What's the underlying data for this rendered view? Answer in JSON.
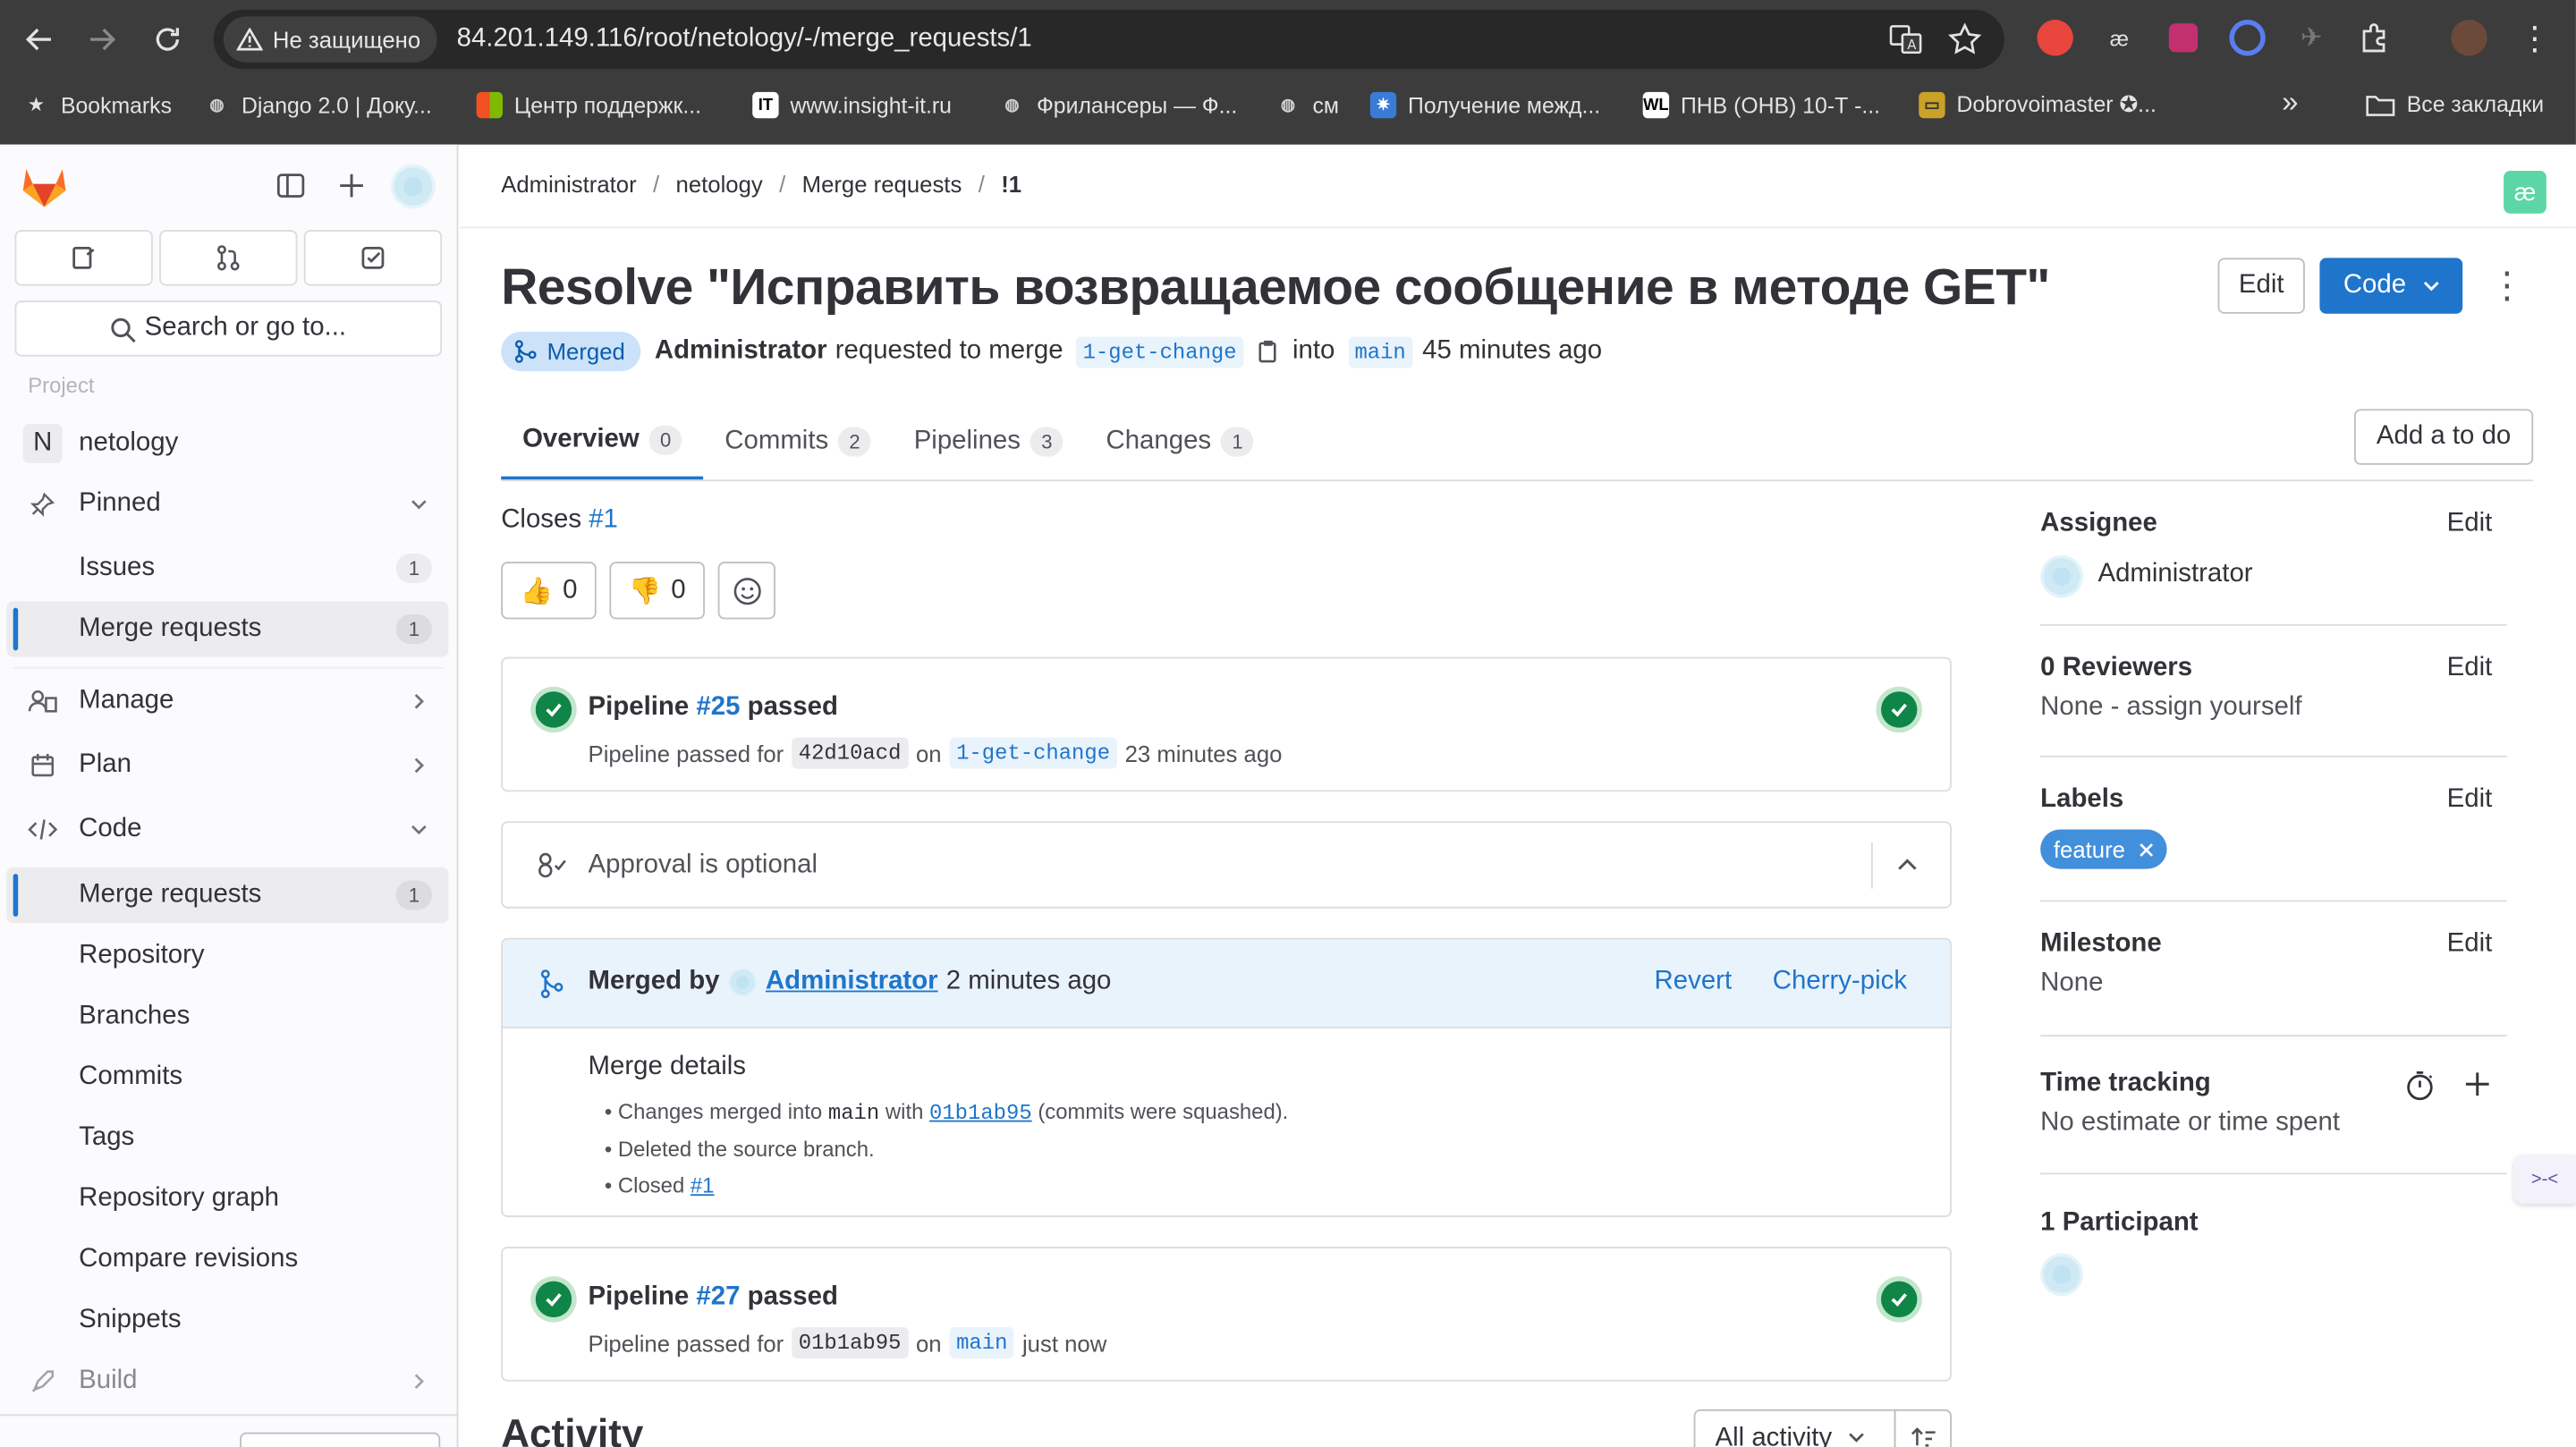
{
  "browser": {
    "insecure_label": "Не защищено",
    "url": "84.201.149.116/root/netology/-/merge_requests/1",
    "bookmarks": [
      {
        "label": "Bookmarks",
        "icon": "star-icon"
      },
      {
        "label": "Django 2.0 | Доку...",
        "icon": "globe-icon"
      },
      {
        "label": "Центр поддержк...",
        "icon": "windows-icon"
      },
      {
        "label": "www.insight-it.ru",
        "icon": "it-icon"
      },
      {
        "label": "Фрилансеры — Ф...",
        "icon": "globe-icon"
      },
      {
        "label": "см",
        "icon": "globe-icon"
      },
      {
        "label": "Получение межд...",
        "icon": "gear-icon"
      },
      {
        "label": "ПНВ (ОНВ) 10-Т -...",
        "icon": "wl-icon"
      },
      {
        "label": "Dobrovoimaster ✪...",
        "icon": "site-icon"
      }
    ],
    "all_bookmarks": "Все закладки",
    "overflow": "»"
  },
  "sidebar": {
    "search_placeholder": "Search or go to...",
    "section_label": "Project",
    "project_initial": "N",
    "project_name": "netology",
    "pinned": "Pinned",
    "pinned_items": [
      {
        "label": "Issues",
        "count": "1"
      },
      {
        "label": "Merge requests",
        "count": "1"
      }
    ],
    "manage": "Manage",
    "plan": "Plan",
    "code": "Code",
    "code_items": [
      {
        "label": "Merge requests",
        "count": "1"
      },
      {
        "label": "Repository"
      },
      {
        "label": "Branches"
      },
      {
        "label": "Commits"
      },
      {
        "label": "Tags"
      },
      {
        "label": "Repository graph"
      },
      {
        "label": "Compare revisions"
      },
      {
        "label": "Snippets"
      }
    ],
    "build": "Build"
  },
  "breadcrumb": [
    "Administrator",
    "netology",
    "Merge requests",
    "!1"
  ],
  "mr": {
    "title": "Resolve \"Исправить возвращаемое сообщение в методе GET\"",
    "edit_button": "Edit",
    "code_button": "Code",
    "status": "Merged",
    "author": "Administrator",
    "requested_text": "requested to merge",
    "source_branch": "1-get-change",
    "into_text": "into",
    "target_branch": "main",
    "time_ago": "45 minutes ago"
  },
  "tabs": [
    {
      "label": "Overview",
      "count": "0"
    },
    {
      "label": "Commits",
      "count": "2"
    },
    {
      "label": "Pipelines",
      "count": "3"
    },
    {
      "label": "Changes",
      "count": "1"
    }
  ],
  "add_todo": "Add a to do",
  "closes": {
    "text": "Closes",
    "ref": "#1"
  },
  "reactions": {
    "thumbs_up": "👍",
    "thumbs_up_count": "0",
    "thumbs_down": "👎",
    "thumbs_down_count": "0"
  },
  "pipeline1": {
    "prefix": "Pipeline",
    "id": "#25",
    "status": "passed",
    "detail_prefix": "Pipeline passed for",
    "sha": "42d10acd",
    "on": "on",
    "branch": "1-get-change",
    "time": "23 minutes ago"
  },
  "approval": {
    "text": "Approval is optional"
  },
  "merged": {
    "prefix": "Merged by",
    "user": "Administrator",
    "time": "2 minutes ago",
    "revert": "Revert",
    "cherry_pick": "Cherry-pick",
    "details_title": "Merge details",
    "line1_a": "Changes merged into",
    "line1_branch": "main",
    "line1_b": "with",
    "line1_sha": "01b1ab95",
    "line1_c": "(commits were squashed).",
    "line2": "Deleted the source branch.",
    "line3_a": "Closed",
    "line3_ref": "#1"
  },
  "pipeline2": {
    "prefix": "Pipeline",
    "id": "#27",
    "status": "passed",
    "detail_prefix": "Pipeline passed for",
    "sha": "01b1ab95",
    "on": "on",
    "branch": "main",
    "time": "just now"
  },
  "activity": {
    "title": "Activity",
    "filter": "All activity"
  },
  "right": {
    "assignee_title": "Assignee",
    "assignee_edit": "Edit",
    "assignee_name": "Administrator",
    "reviewers_title": "0 Reviewers",
    "reviewers_edit": "Edit",
    "reviewers_value": "None - assign yourself",
    "labels_title": "Labels",
    "labels_edit": "Edit",
    "label_name": "feature",
    "milestone_title": "Milestone",
    "milestone_edit": "Edit",
    "milestone_value": "None",
    "time_title": "Time tracking",
    "time_value": "No estimate or time spent",
    "participants_title": "1 Participant"
  },
  "colors": {
    "accent": "#1f75cb",
    "success": "#108548",
    "label_bg": "#428fdc",
    "merged_badge_bg": "#cbe2f9"
  }
}
